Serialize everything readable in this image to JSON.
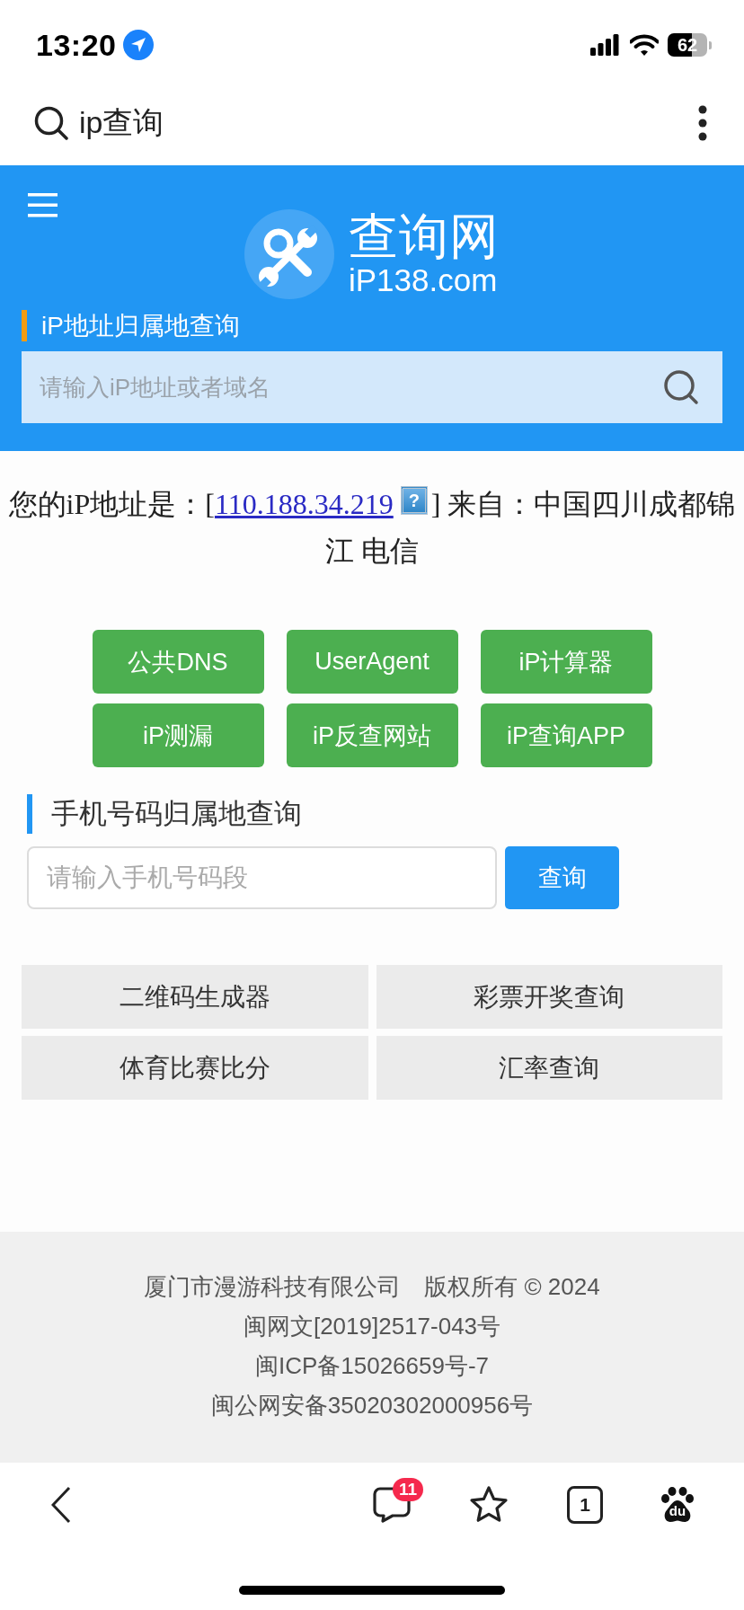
{
  "status_bar": {
    "time": "13:20",
    "battery": "62"
  },
  "browser_bar": {
    "query": "ip查询"
  },
  "header": {
    "logo_title": "查询网",
    "logo_domain": "iP138.com",
    "section_title": "iP地址归属地查询",
    "search": {
      "placeholder": "请输入iP地址或者域名"
    }
  },
  "ip_info": {
    "prefix": "您的iP地址是：[",
    "ip": "110.188.34.219",
    "help_icon": "?",
    "suffix": "] 来自：中国四川成都锦江 电信"
  },
  "tool_buttons": [
    "公共DNS",
    "UserAgent",
    "iP计算器",
    "iP测漏",
    "iP反查网站",
    "iP查询APP"
  ],
  "phone_lookup": {
    "title": "手机号码归属地查询",
    "placeholder": "请输入手机号码段",
    "button": "查询"
  },
  "links": [
    "二维码生成器",
    "彩票开奖查询",
    "体育比赛比分",
    "汇率查询"
  ],
  "footer": {
    "lines": [
      "厦门市漫游科技有限公司　版权所有 © 2024",
      "闽网文[2019]2517-043号",
      "闽ICP备15026659号-7",
      "闽公网安备35020302000956号"
    ]
  },
  "bottom_bar": {
    "message_badge": "11",
    "tab_count": "1",
    "logo_text": "du"
  }
}
